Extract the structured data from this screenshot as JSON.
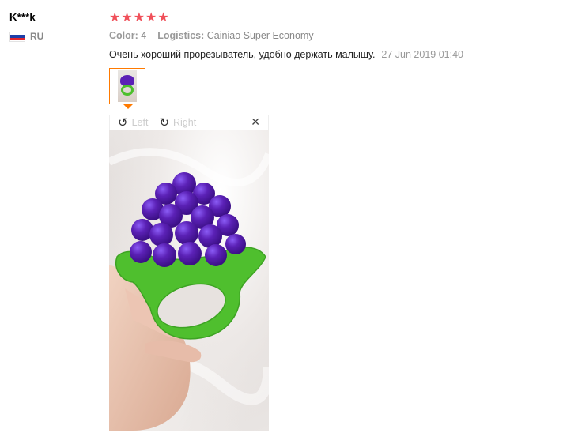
{
  "reviewer": {
    "name": "K***k",
    "country_code": "RU",
    "flag_colors": [
      "#ffffff",
      "#1c3fa8",
      "#e0262d"
    ]
  },
  "rating": {
    "stars": 5,
    "star_glyph": "★",
    "color": "#f0505a"
  },
  "order": {
    "color_label": "Color:",
    "color_value": "4",
    "logistics_label": "Logistics:",
    "logistics_value": "Cainiao Super Economy"
  },
  "review": {
    "text": "Очень хороший прорезыватель, удобно держать малышу.",
    "date": "27 Jun 2019 01:40"
  },
  "viewer": {
    "rotate_left_icon": "↺",
    "rotate_left_label": "Left",
    "rotate_right_icon": "↻",
    "rotate_right_label": "Right",
    "close_icon": "✕",
    "accent": "#ff7a00"
  }
}
